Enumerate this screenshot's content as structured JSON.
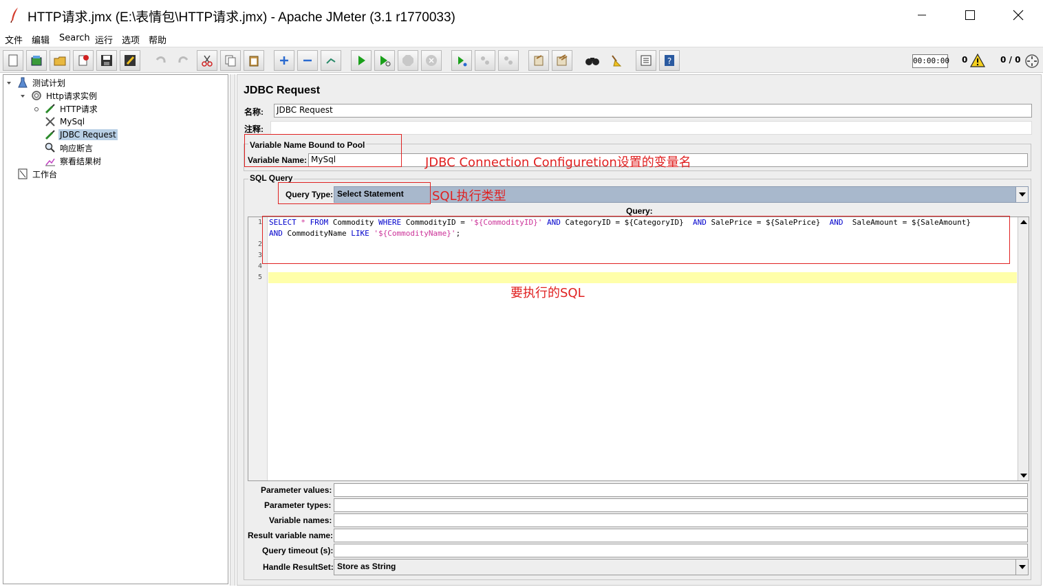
{
  "window": {
    "title": "HTTP请求.jmx (E:\\表情包\\HTTP请求.jmx) - Apache JMeter (3.1 r1770033)"
  },
  "menu": [
    "文件",
    "编辑",
    "Search",
    "运行",
    "选项",
    "帮助"
  ],
  "toolbar": {
    "timer": "00:00:00",
    "error_count": "0",
    "threads": "0 / 0",
    "buttons": [
      "new-icon",
      "templates-icon",
      "open-icon",
      "close-icon",
      "save-icon",
      "save-as-icon",
      "undo-icon",
      "redo-icon",
      "cut-icon",
      "copy-icon",
      "paste-icon",
      "expand-icon",
      "collapse-icon",
      "toggle-icon",
      "start-icon",
      "start-no-pause-icon",
      "stop-icon",
      "shutdown-icon",
      "remote-start-icon",
      "remote-stop-icon",
      "remote-shutdown-icon",
      "clear-icon",
      "clear-all-icon",
      "search-icon",
      "reset-search-icon",
      "function-helper-icon",
      "help-icon"
    ]
  },
  "tree": {
    "items": [
      {
        "label": "测试计划",
        "icon": "test-plan-icon"
      },
      {
        "label": "Http请求实例",
        "icon": "thread-group-icon"
      },
      {
        "label": "HTTP请求",
        "icon": "sampler-icon"
      },
      {
        "label": "MySql",
        "icon": "config-icon"
      },
      {
        "label": "JDBC Request",
        "icon": "sampler-icon"
      },
      {
        "label": "响应断言",
        "icon": "assertion-icon"
      },
      {
        "label": "察看结果树",
        "icon": "listener-icon"
      },
      {
        "label": "工作台",
        "icon": "workbench-icon"
      }
    ]
  },
  "form": {
    "section_title": "JDBC Request",
    "name_label": "名称:",
    "name_value": "JDBC Request",
    "comment_label": "注释:",
    "comment_value": "",
    "pool_group_title": "Variable Name Bound to Pool",
    "variable_name_label": "Variable Name:",
    "variable_name_value": "MySql",
    "sql_group_title": "SQL Query",
    "query_type_label": "Query Type:",
    "query_type_value": "Select Statement",
    "query_label": "Query:",
    "query_lines": [
      "SELECT * FROM Commodity WHERE CommodityID = '${CommodityID}' AND CategoryID = ${CategoryID}  AND SalePrice = ${SalePrice}  AND  SaleAmount = ${SaleAmount}",
      "AND CommodityName LIKE '${CommodityName}';",
      "",
      "",
      "",
      ""
    ],
    "line_numbers": [
      "1",
      "2",
      "3",
      "4",
      "5"
    ],
    "parameter_values_label": "Parameter values:",
    "parameter_values_value": "",
    "parameter_types_label": "Parameter types:",
    "parameter_types_value": "",
    "variable_names_label": "Variable names:",
    "variable_names_value": "",
    "result_variable_name_label": "Result variable name:",
    "result_variable_name_value": "",
    "query_timeout_label": "Query timeout (s):",
    "query_timeout_value": "",
    "handle_resultset_label": "Handle ResultSet:",
    "handle_resultset_value": "Store as String"
  },
  "annotations": {
    "variable_name_note": "JDBC Connection Configuretion设置的变量名",
    "query_type_note": "SQL执行类型",
    "sql_note": "要执行的SQL"
  },
  "colors": {
    "annotation_red": "#e02020",
    "selection_blue": "#b8cfe5",
    "combo_blue": "#a8b8cc",
    "keyword_blue": "#0000cc",
    "string_pink": "#cc3399",
    "current_line": "#ffffaa"
  }
}
